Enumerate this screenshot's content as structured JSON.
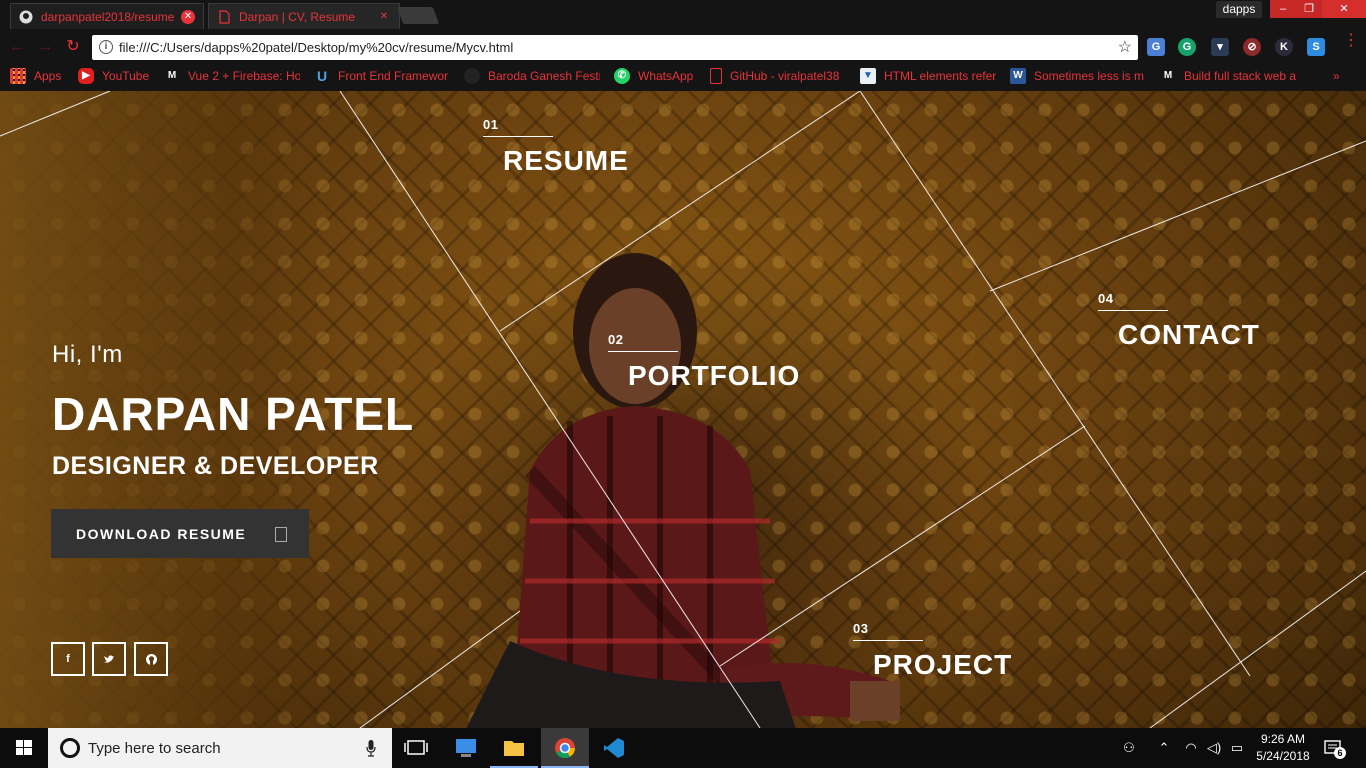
{
  "browser": {
    "tabs": [
      {
        "title": "darpanpatel2018/resume",
        "active": false
      },
      {
        "title": "Darpan | CV, Resume",
        "active": true
      }
    ],
    "profile": "dapps",
    "url": "file:///C:/Users/dapps%20patel/Desktop/my%20cv/resume/Mycv.html",
    "extensions": [
      "G",
      "K",
      "S"
    ],
    "bookmarks": [
      {
        "label": "Apps",
        "icon": "apps-grid-icon"
      },
      {
        "label": "YouTube",
        "icon": "youtube-icon"
      },
      {
        "label": "Vue 2 + Firebase: Ho",
        "icon": "medium-icon"
      },
      {
        "label": "Front End Framewor",
        "icon": "udemy-icon"
      },
      {
        "label": "Baroda Ganesh Festi",
        "icon": "circle-icon"
      },
      {
        "label": "WhatsApp",
        "icon": "whatsapp-icon"
      },
      {
        "label": "GitHub - viralpatel38",
        "icon": "document-icon"
      },
      {
        "label": "HTML elements refer",
        "icon": "bookmark-icon"
      },
      {
        "label": "Sometimes less is m",
        "icon": "word-icon"
      },
      {
        "label": "Build full stack web a",
        "icon": "medium-icon"
      }
    ],
    "more": "»"
  },
  "hero": {
    "greeting": "Hi, I'm",
    "name": "DARPAN PATEL",
    "role": "DESIGNER & DEVELOPER",
    "download_label": "DOWNLOAD RESUME",
    "social": [
      {
        "name": "facebook",
        "glyph": "f"
      },
      {
        "name": "twitter",
        "glyph": "t"
      },
      {
        "name": "github",
        "glyph": "g"
      }
    ]
  },
  "nav": [
    {
      "num": "01",
      "label": "RESUME"
    },
    {
      "num": "02",
      "label": "PORTFOLIO"
    },
    {
      "num": "03",
      "label": "PROJECT"
    },
    {
      "num": "04",
      "label": "CONTACT"
    }
  ],
  "taskbar": {
    "search_placeholder": "Type here to search",
    "time": "9:26 AM",
    "date": "5/24/2018",
    "notifications": "6"
  },
  "colors": {
    "accent": "#e8333a",
    "chrome_bg": "#141414",
    "button_bg": "#333333"
  }
}
